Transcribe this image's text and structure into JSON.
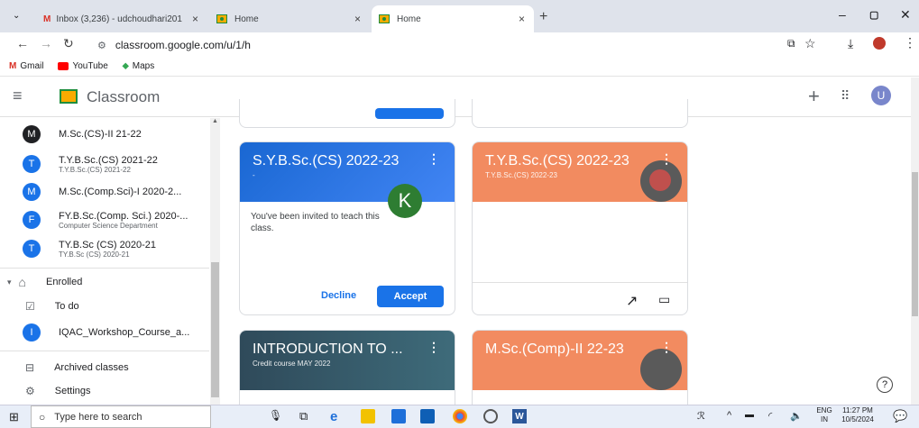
{
  "browser": {
    "tabs": [
      {
        "label": "Inbox (3,236) - udchoudhari201",
        "icon": "gmail-icon"
      },
      {
        "label": "Home",
        "icon": "classroom-icon"
      },
      {
        "label": "Home",
        "icon": "classroom-icon"
      }
    ],
    "url": "classroom.google.com/u/1/h",
    "bookmarks": [
      {
        "label": "Gmail",
        "icon": "gmail-icon"
      },
      {
        "label": "YouTube",
        "icon": "youtube-icon"
      },
      {
        "label": "Maps",
        "icon": "maps-icon"
      }
    ]
  },
  "header": {
    "app_title": "Classroom",
    "avatar_letter": "U"
  },
  "sidebar": {
    "teaching_items": [
      {
        "letter": "M",
        "color": "#202124",
        "title": "M.Sc.(CS)-II 21-22",
        "subtitle": ""
      },
      {
        "letter": "T",
        "color": "#1a73e8",
        "title": "T.Y.B.Sc.(CS) 2021-22",
        "subtitle": "T.Y.B.Sc.(CS) 2021-22"
      },
      {
        "letter": "M",
        "color": "#1a73e8",
        "title": "M.Sc.(Comp.Sci)-I 2020-2...",
        "subtitle": ""
      },
      {
        "letter": "F",
        "color": "#1a73e8",
        "title": "FY.B.Sc.(Comp. Sci.) 2020-...",
        "subtitle": "Computer Science Department"
      },
      {
        "letter": "T",
        "color": "#1a73e8",
        "title": "TY.B.Sc (CS) 2020-21",
        "subtitle": "TY.B.Sc (CS) 2020-21"
      }
    ],
    "enrolled_label": "Enrolled",
    "todo_label": "To do",
    "enrolled_items": [
      {
        "letter": "I",
        "color": "#1a73e8",
        "title": "IQAC_Workshop_Course_a..."
      }
    ],
    "archived_label": "Archived classes",
    "settings_label": "Settings"
  },
  "cards": [
    {
      "title": "S.Y.B.Sc.(CS) 2022-23",
      "subtitle": "-",
      "banner_color": "#1967d2",
      "owner_letter": "K",
      "invite_text": "You've been invited to teach this class.",
      "decline_label": "Decline",
      "accept_label": "Accept"
    },
    {
      "title": "T.Y.B.Sc.(CS) 2022-23",
      "subtitle": "T.Y.B.Sc.(CS) 2022-23",
      "banner_color": "#f28b60"
    },
    {
      "title": "INTRODUCTION TO ...",
      "subtitle": "Credit course MAY 2022",
      "banner_color": "#2f4a5a"
    },
    {
      "title": "M.Sc.(Comp)-II 22-23",
      "subtitle": "",
      "banner_color": "#f28b60"
    }
  ],
  "taskbar": {
    "search_placeholder": "Type here to search",
    "lang_line1": "ENG",
    "lang_line2": "IN",
    "time": "11:27 PM",
    "date": "10/5/2024"
  },
  "colors": {
    "accent": "#1a73e8",
    "green": "#1e8e3e"
  }
}
